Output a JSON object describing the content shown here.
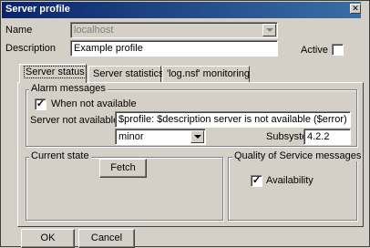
{
  "window": {
    "title": "Server profile",
    "close_glyph": "✕",
    "close_icon": "close-icon"
  },
  "profile": {
    "name_label": "Name",
    "name_value": "localhost",
    "description_label": "Description",
    "description_value": "Example profile",
    "active_label": "Active",
    "active_checked": false
  },
  "tabs": [
    {
      "label": "Server status",
      "active": true
    },
    {
      "label": "Server statistics",
      "active": false
    },
    {
      "label": "'log.nsf' monitoring",
      "active": false
    }
  ],
  "alarm": {
    "group_title": "Alarm messages",
    "when_not_available_label": "When not available",
    "when_not_available_checked": true,
    "check_glyph": "✓",
    "server_not_available_label": "Server not available",
    "message_value": "$profile: $description server is not available ($error)",
    "severity_value": "minor",
    "subsystem_label": "Subsystem",
    "subsystem_value": "4.2.2"
  },
  "current_state": {
    "group_title": "Current state",
    "fetch_label": "Fetch"
  },
  "qos": {
    "group_title": "Quality of Service messages",
    "availability_label": "Availability",
    "availability_checked": true
  },
  "footer": {
    "ok_label": "OK",
    "cancel_label": "Cancel"
  }
}
